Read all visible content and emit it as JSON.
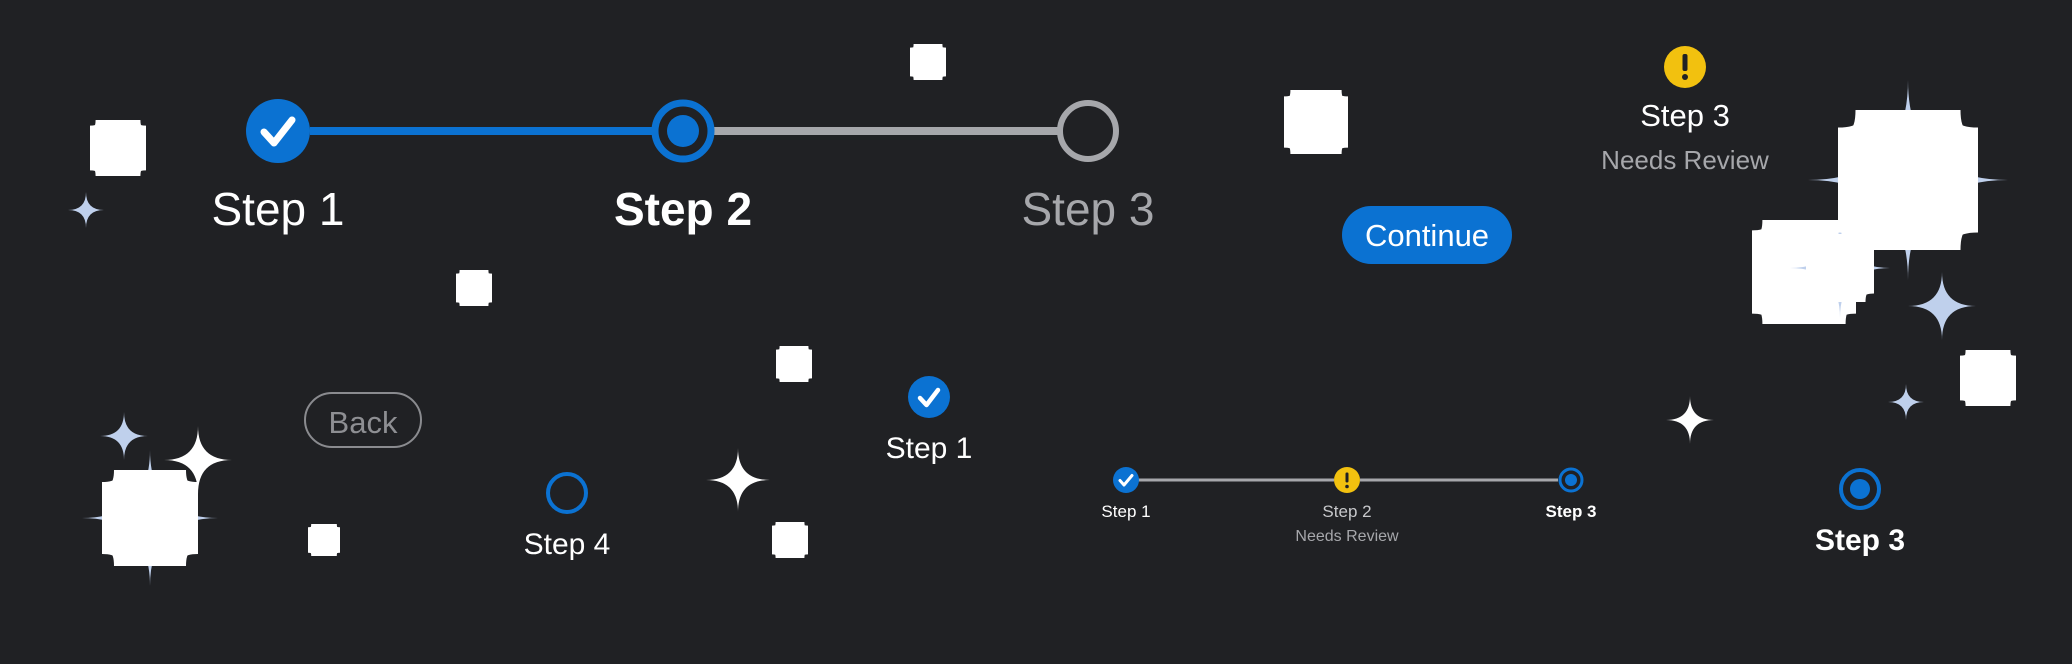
{
  "colors": {
    "background": "#202124",
    "accent": "#0b72d2",
    "inactive": "#a6a7ab",
    "warning": "#f2c10f",
    "sparkle_fill": "#bfd0ec",
    "text": "#ffffff"
  },
  "stepper_large": {
    "steps": [
      {
        "label": "Step 1",
        "state": "completed",
        "icon": "check-icon"
      },
      {
        "label": "Step 2",
        "state": "current",
        "icon": "dot-icon"
      },
      {
        "label": "Step 3",
        "state": "upcoming",
        "icon": "empty-circle-icon"
      }
    ]
  },
  "alert_step": {
    "label": "Step 3",
    "sublabel": "Needs Review",
    "icon": "exclamation-icon"
  },
  "buttons": {
    "continue": "Continue",
    "back": "Back"
  },
  "single_steps": {
    "step1": {
      "label": "Step 1",
      "state": "completed",
      "icon": "check-icon"
    },
    "step4": {
      "label": "Step 4",
      "state": "upcoming",
      "icon": "empty-circle-icon"
    },
    "step3": {
      "label": "Step 3",
      "state": "current",
      "icon": "dot-icon"
    }
  },
  "stepper_small": {
    "steps": [
      {
        "label": "Step 1",
        "state": "completed",
        "icon": "check-icon"
      },
      {
        "label": "Step 2",
        "sublabel": "Needs Review",
        "state": "warning",
        "icon": "exclamation-icon"
      },
      {
        "label": "Step 3",
        "state": "current",
        "icon": "dot-icon"
      }
    ]
  }
}
